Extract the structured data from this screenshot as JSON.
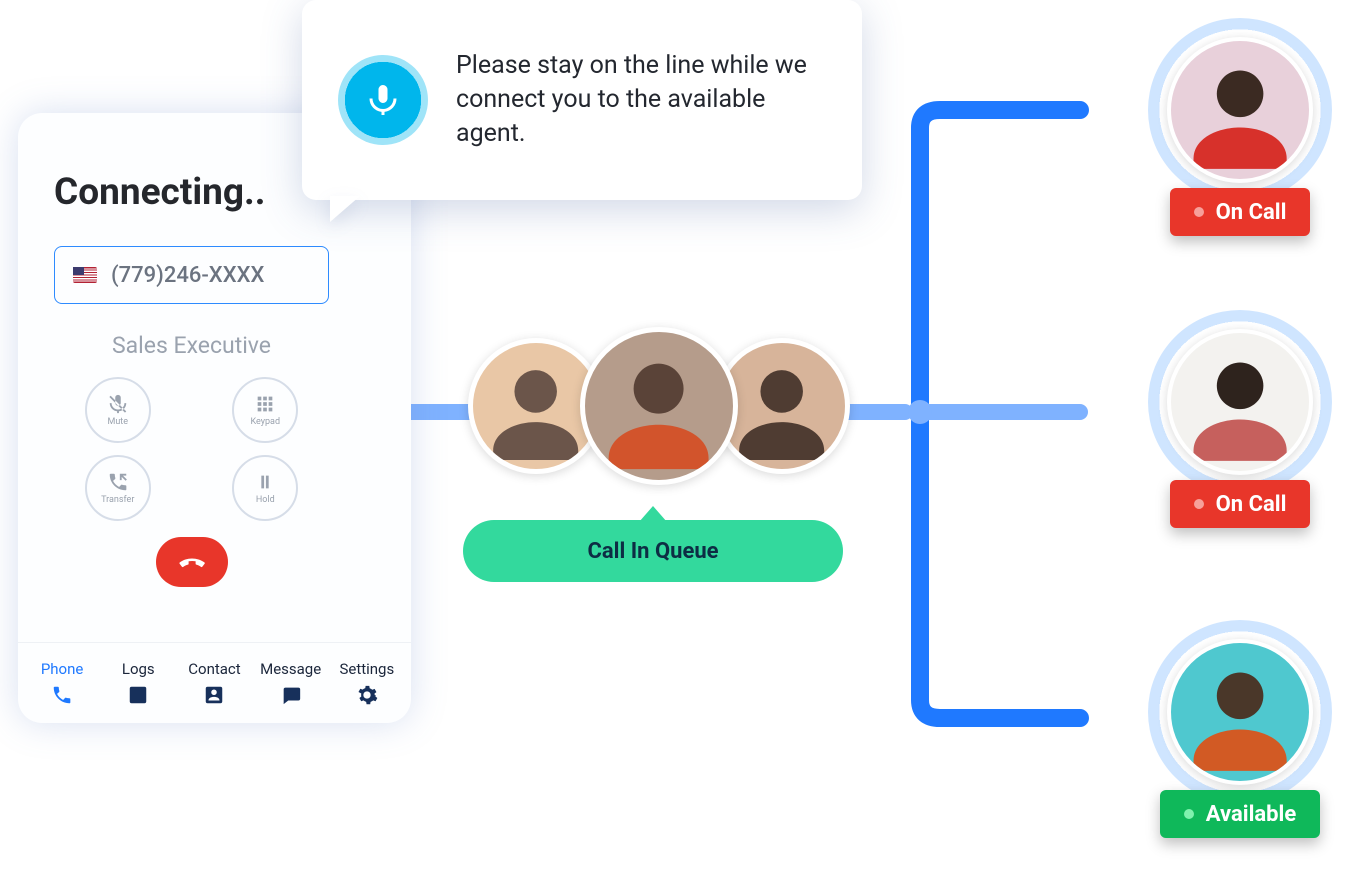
{
  "phone": {
    "title": "Connecting..",
    "number": "(779)246-XXXX",
    "role": "Sales Executive",
    "controls": {
      "mute": "Mute",
      "keypad": "Keypad",
      "transfer": "Transfer",
      "hold": "Hold"
    },
    "tabs": {
      "phone": "Phone",
      "logs": "Logs",
      "contact": "Contact",
      "message": "Message",
      "settings": "Settings"
    }
  },
  "bubble": {
    "text": "Please stay on the line while we connect you to the available agent."
  },
  "queue": {
    "pill": "Call In Queue"
  },
  "agents": {
    "a1_status": "On Call",
    "a2_status": "On Call",
    "a3_status": "Available"
  }
}
